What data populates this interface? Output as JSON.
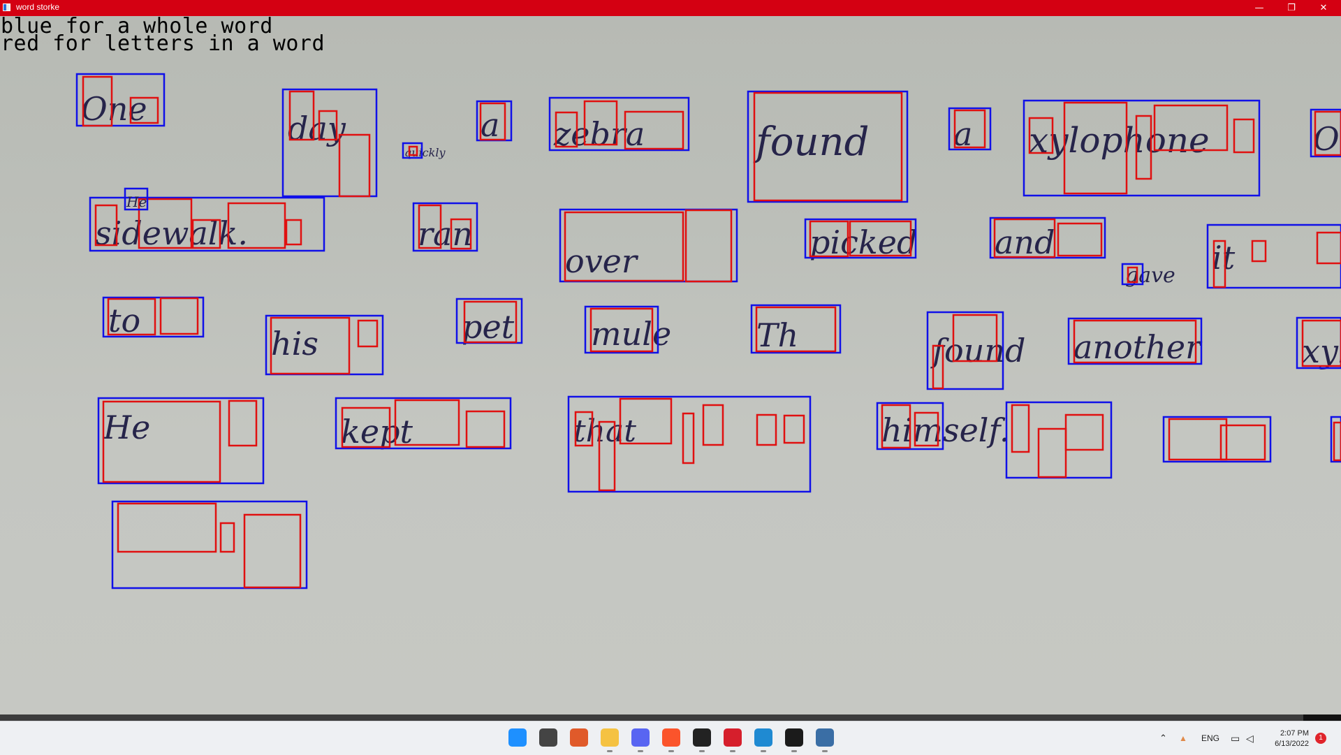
{
  "window": {
    "title": "word storke",
    "minimize_glyph": "—",
    "restore_glyph": "❐",
    "close_glyph": "✕"
  },
  "legend": {
    "line1": "blue for a whole word",
    "line2": "red for letters in a word"
  },
  "colors": {
    "titlebar": "#d40012",
    "word_box": "#1010e8",
    "letter_box": "#e01010",
    "ink": "#26244a"
  },
  "words": [
    {
      "text": "One"
    },
    {
      "text": "day"
    },
    {
      "text": "a"
    },
    {
      "text": "zebra"
    },
    {
      "text": "found"
    },
    {
      "text": "a"
    },
    {
      "text": "xylophone"
    },
    {
      "text": "O"
    },
    {
      "text": "sidewalk."
    },
    {
      "text": "He"
    },
    {
      "text": "quickly"
    },
    {
      "text": "ran"
    },
    {
      "text": "over"
    },
    {
      "text": "picked"
    },
    {
      "text": "and"
    },
    {
      "text": "gave"
    },
    {
      "text": "it"
    },
    {
      "text": "to"
    },
    {
      "text": "his"
    },
    {
      "text": "pet"
    },
    {
      "text": "mule"
    },
    {
      "text": "Th"
    },
    {
      "text": "found"
    },
    {
      "text": "another"
    },
    {
      "text": "xylophone."
    },
    {
      "text": "He"
    },
    {
      "text": "kept"
    },
    {
      "text": "that"
    },
    {
      "text": "himself."
    }
  ],
  "taskbar": {
    "apps": [
      {
        "icon": "windows-start-icon",
        "color": "#1e90ff"
      },
      {
        "icon": "task-view-icon",
        "color": "#444444"
      },
      {
        "icon": "cube-app-icon",
        "color": "#e05a2a"
      },
      {
        "icon": "file-explorer-icon",
        "color": "#f5c242"
      },
      {
        "icon": "discord-icon",
        "color": "#5865f2"
      },
      {
        "icon": "brave-browser-icon",
        "color": "#fb542b"
      },
      {
        "icon": "unity-hub-icon",
        "color": "#222222"
      },
      {
        "icon": "red-app-icon",
        "color": "#d61f2c"
      },
      {
        "icon": "vscode-icon",
        "color": "#1f8ad2"
      },
      {
        "icon": "terminal-icon",
        "color": "#1b1b1b"
      },
      {
        "icon": "python-app-icon",
        "color": "#3a6ea5"
      }
    ],
    "tray": {
      "language": "ENG",
      "time": "2:07 PM",
      "date": "6/13/2022",
      "notifications": "1"
    }
  }
}
